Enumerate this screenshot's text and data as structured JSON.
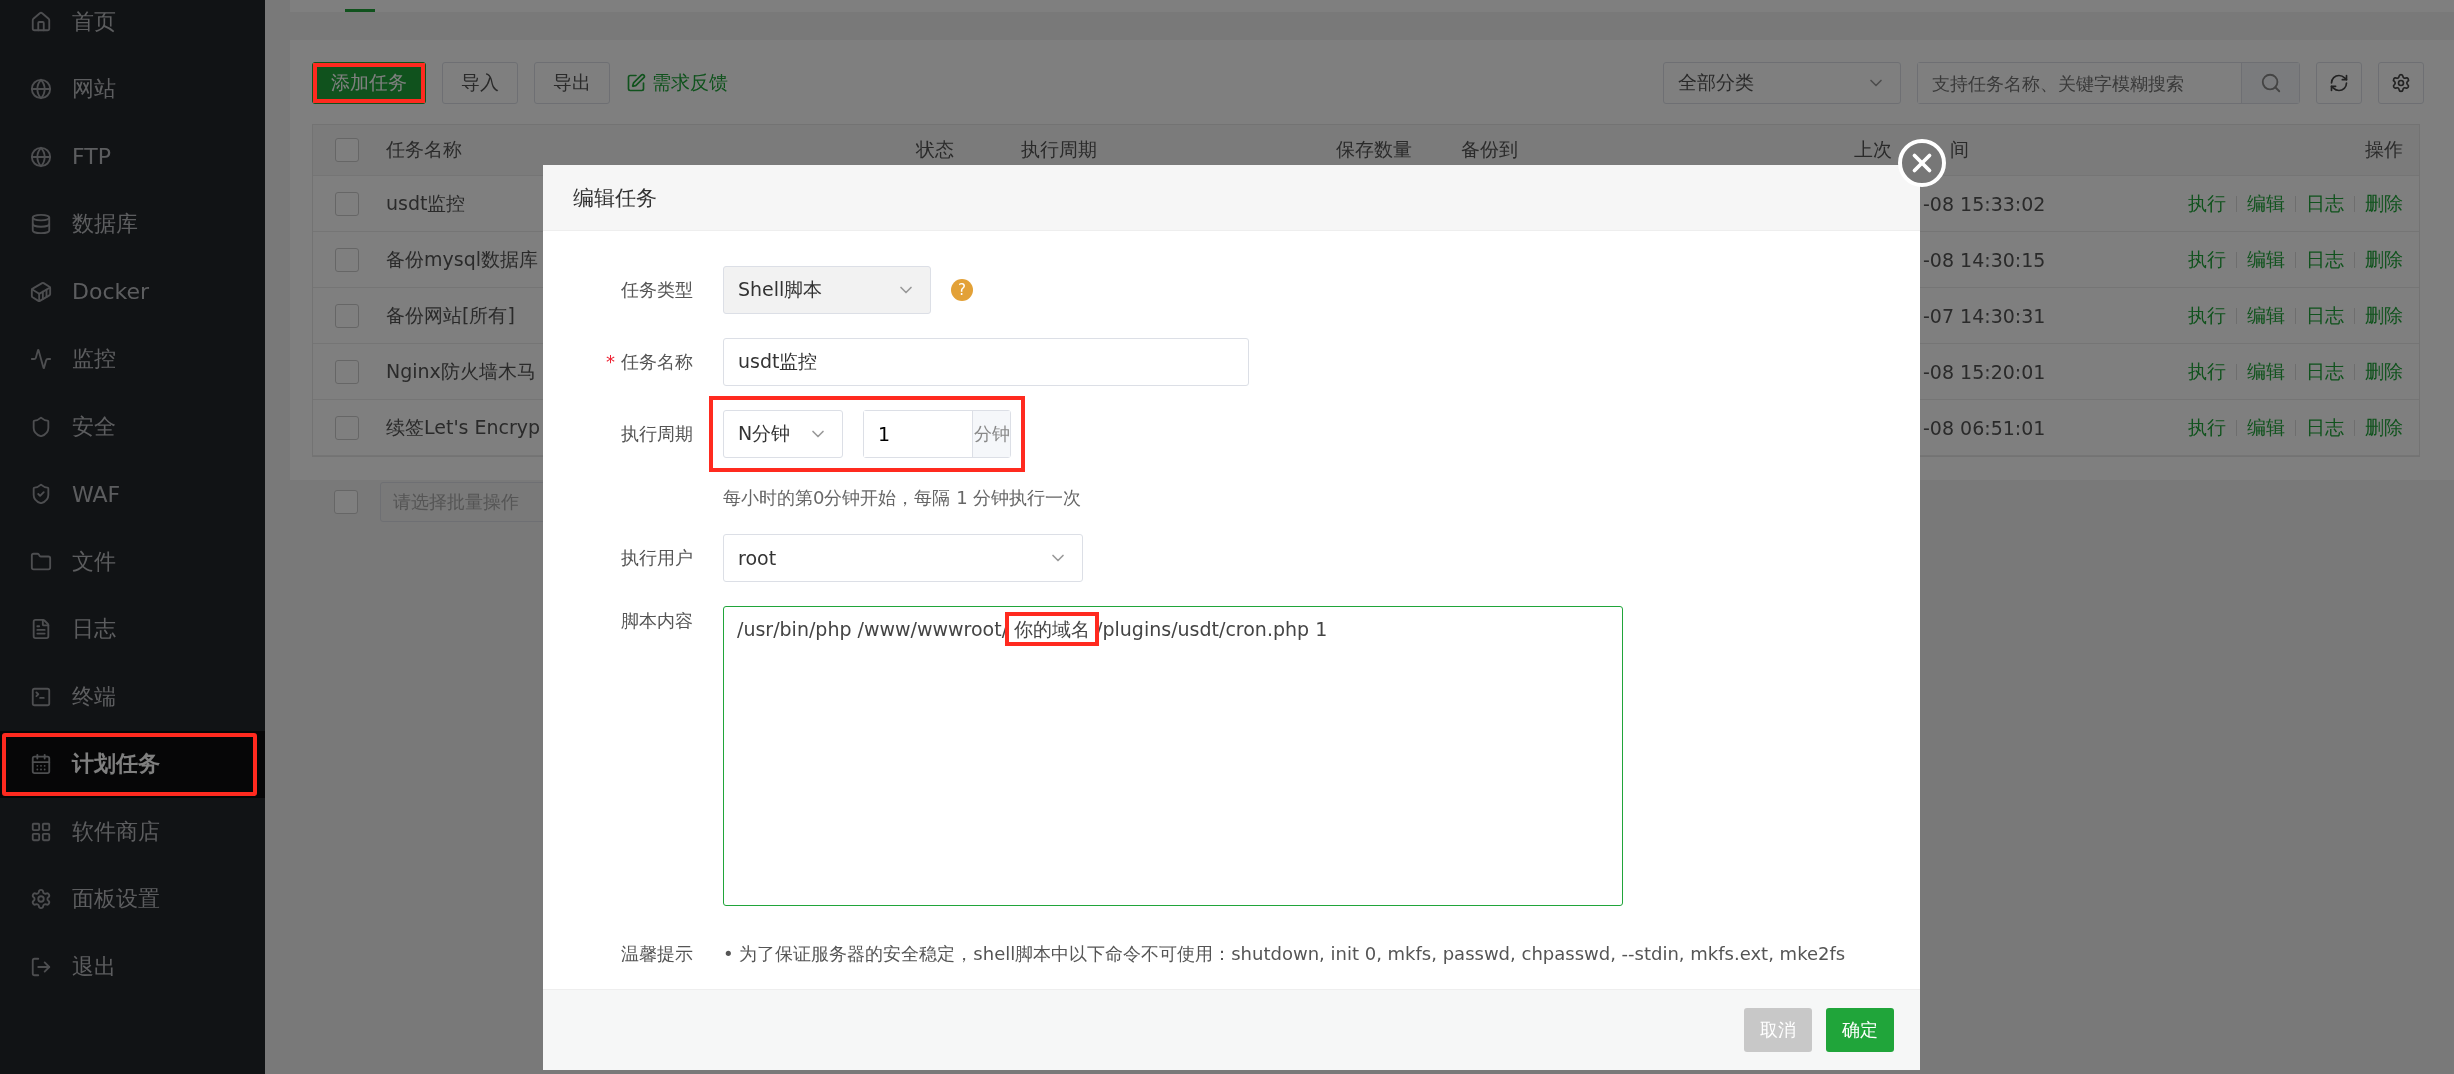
{
  "sidebar": {
    "items": [
      {
        "label": "首页",
        "selected": false,
        "highlighted": false
      },
      {
        "label": "网站",
        "selected": false,
        "highlighted": false
      },
      {
        "label": "FTP",
        "selected": false,
        "highlighted": false
      },
      {
        "label": "数据库",
        "selected": false,
        "highlighted": false
      },
      {
        "label": "Docker",
        "selected": false,
        "highlighted": false
      },
      {
        "label": "监控",
        "selected": false,
        "highlighted": false
      },
      {
        "label": "安全",
        "selected": false,
        "highlighted": false
      },
      {
        "label": "WAF",
        "selected": false,
        "highlighted": false
      },
      {
        "label": "文件",
        "selected": false,
        "highlighted": false
      },
      {
        "label": "日志",
        "selected": false,
        "highlighted": false
      },
      {
        "label": "终端",
        "selected": false,
        "highlighted": false
      },
      {
        "label": "计划任务",
        "selected": true,
        "highlighted": true
      },
      {
        "label": "软件商店",
        "selected": false,
        "highlighted": false
      },
      {
        "label": "面板设置",
        "selected": false,
        "highlighted": false
      },
      {
        "label": "退出",
        "selected": false,
        "highlighted": false
      }
    ]
  },
  "toolbar": {
    "buttons": [
      {
        "label": "添加任务",
        "kind": "primary",
        "highlighted": true
      },
      {
        "label": "导入",
        "kind": "default",
        "highlighted": false
      },
      {
        "label": "导出",
        "kind": "default",
        "highlighted": false
      }
    ],
    "feedback_link": "需求反馈",
    "category": "全部分类",
    "search": {
      "placeholder": "支持任务名称、关键字模糊搜索"
    }
  },
  "table": {
    "select_all_checked": false,
    "columns": [
      "任务名称",
      "状态",
      "执行周期",
      "保存数量",
      "备份到",
      "上次",
      "操作"
    ],
    "column_5_tail": "间",
    "rows": [
      {
        "checked": false,
        "name": "usdt监控",
        "last_run": "-08 15:33:02",
        "actions": [
          "执行",
          "编辑",
          "日志",
          "删除"
        ]
      },
      {
        "checked": false,
        "name": "备份mysql数据库",
        "last_run": "-08 14:30:15",
        "actions": [
          "执行",
          "编辑",
          "日志",
          "删除"
        ]
      },
      {
        "checked": false,
        "name": "备份网站[所有]",
        "last_run": "-07 14:30:31",
        "actions": [
          "执行",
          "编辑",
          "日志",
          "删除"
        ]
      },
      {
        "checked": false,
        "name": "Nginx防火墙木马",
        "last_run": "-08 15:20:01",
        "actions": [
          "执行",
          "编辑",
          "日志",
          "删除"
        ]
      },
      {
        "checked": false,
        "name": "续签Let's Encryp",
        "last_run": "-08 06:51:01",
        "actions": [
          "执行",
          "编辑",
          "日志",
          "删除"
        ]
      }
    ],
    "batch": {
      "checked": false,
      "placeholder": "请选择批量操作"
    }
  },
  "dialog": {
    "title": "编辑任务",
    "task_type": {
      "label": "任务类型",
      "value": "Shell脚本",
      "help": "?"
    },
    "task_name": {
      "label": "任务名称",
      "required_mark": "*",
      "value": "usdt监控"
    },
    "schedule": {
      "label": "执行周期",
      "highlighted": true,
      "unit_select": "N分钟",
      "value": "1",
      "suffix": "分钟",
      "hint": "每小时的第0分钟开始，每隔 1 分钟执行一次"
    },
    "user": {
      "label": "执行用户",
      "value": "root"
    },
    "script": {
      "label": "脚本内容",
      "parts": [
        {
          "text": "/usr/bin/php /www/wwwroot/",
          "highlighted": false
        },
        {
          "text": "你的域名",
          "highlighted": true
        },
        {
          "text": "/plugins/usdt/cron.php 1",
          "highlighted": false
        }
      ]
    },
    "tip": {
      "label": "温馨提示",
      "bullet": "•",
      "text": "为了保证服务器的安全稳定，shell脚本中以下命令不可使用：shutdown, init 0, mkfs, passwd, chpasswd, --stdin, mkfs.ext, mke2fs"
    },
    "buttons": [
      {
        "label": "取消",
        "kind": "cancel"
      },
      {
        "label": "确定",
        "kind": "confirm"
      }
    ]
  }
}
